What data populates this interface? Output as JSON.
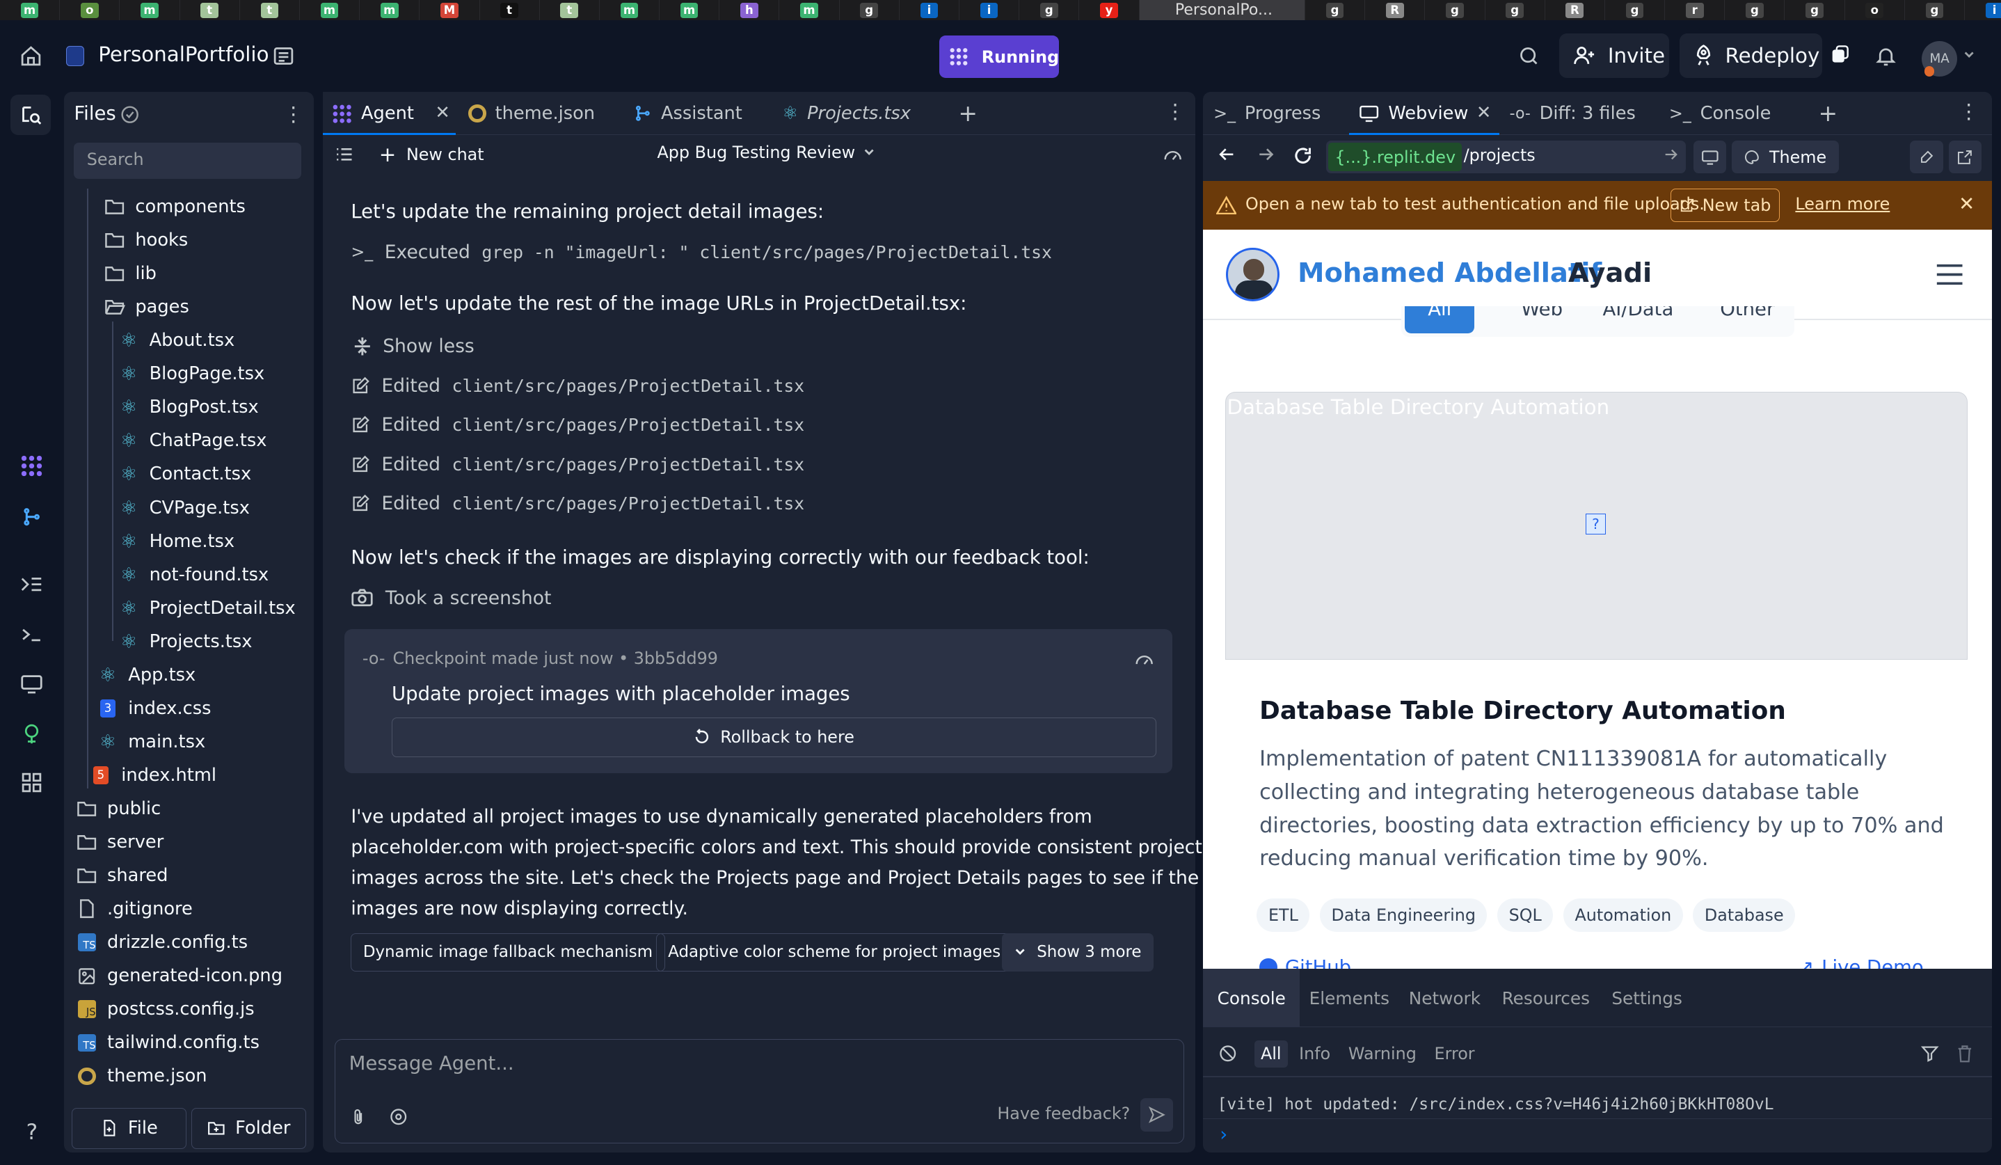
{
  "browser_tabs": {
    "active_title": "PersonalPo...",
    "favicons": [
      "m",
      "ov",
      "m",
      "tu",
      "tu",
      "m",
      "m",
      "M",
      "tt",
      "tu",
      "m",
      "m",
      "hx",
      "m",
      "gh",
      "in",
      "in",
      "gh",
      "yt",
      "active",
      "gh",
      "R",
      "gh",
      "gh",
      "R",
      "gh",
      "reddit",
      "gh",
      "gh",
      "openai",
      "gh",
      "in"
    ]
  },
  "topbar": {
    "project_name": "PersonalPortfolio",
    "status": "Running",
    "invite_label": "Invite",
    "redeploy_label": "Redeploy",
    "avatar_initials": "MA"
  },
  "files": {
    "title": "Files",
    "search_placeholder": "Search",
    "items": [
      {
        "name": "components",
        "type": "folder"
      },
      {
        "name": "hooks",
        "type": "folder"
      },
      {
        "name": "lib",
        "type": "folder"
      },
      {
        "name": "pages",
        "type": "folder-open"
      },
      {
        "name": "About.tsx",
        "type": "react"
      },
      {
        "name": "BlogPage.tsx",
        "type": "react"
      },
      {
        "name": "BlogPost.tsx",
        "type": "react"
      },
      {
        "name": "ChatPage.tsx",
        "type": "react"
      },
      {
        "name": "Contact.tsx",
        "type": "react"
      },
      {
        "name": "CVPage.tsx",
        "type": "react"
      },
      {
        "name": "Home.tsx",
        "type": "react"
      },
      {
        "name": "not-found.tsx",
        "type": "react"
      },
      {
        "name": "ProjectDetail.tsx",
        "type": "react"
      },
      {
        "name": "Projects.tsx",
        "type": "react"
      },
      {
        "name": "App.tsx",
        "type": "react"
      },
      {
        "name": "index.css",
        "type": "css"
      },
      {
        "name": "main.tsx",
        "type": "react"
      },
      {
        "name": "index.html",
        "type": "html"
      },
      {
        "name": "public",
        "type": "folder"
      },
      {
        "name": "server",
        "type": "folder"
      },
      {
        "name": "shared",
        "type": "folder"
      },
      {
        "name": ".gitignore",
        "type": "file"
      },
      {
        "name": "drizzle.config.ts",
        "type": "ts"
      },
      {
        "name": "generated-icon.png",
        "type": "image"
      },
      {
        "name": "postcss.config.js",
        "type": "js"
      },
      {
        "name": "tailwind.config.ts",
        "type": "ts"
      },
      {
        "name": "theme.json",
        "type": "json"
      }
    ],
    "new_file_label": "File",
    "new_folder_label": "Folder"
  },
  "agent_tabs": [
    {
      "label": "Agent"
    },
    {
      "label": "theme.json"
    },
    {
      "label": "Assistant"
    },
    {
      "label": "Projects.tsx"
    }
  ],
  "agent_toolbar": {
    "new_chat_label": "New chat",
    "chat_title": "App Bug Testing Review"
  },
  "chat": {
    "msg1": "Let's update the remaining project detail images:",
    "exec_prefix": "Executed",
    "exec_cmd": "grep -n \"imageUrl: \" client/src/pages/ProjectDetail.tsx",
    "msg2": "Now let's update the rest of the image URLs in ProjectDetail.tsx:",
    "show_less": "Show less",
    "edit_prefix": "Edited",
    "edits": [
      "client/src/pages/ProjectDetail.tsx",
      "client/src/pages/ProjectDetail.tsx",
      "client/src/pages/ProjectDetail.tsx",
      "client/src/pages/ProjectDetail.tsx"
    ],
    "msg3": "Now let's check if the images are displaying correctly with our feedback tool:",
    "screenshot_label": "Took a screenshot",
    "checkpoint": {
      "meta": "Checkpoint made just now • 3bb5dd99",
      "title": "Update project images with placeholder images",
      "rollback_label": "Rollback to here"
    },
    "summary_lines": [
      "I've updated all project images to use dynamically generated placeholders from",
      "placeholder.com with project-specific colors and text. This should provide consistent project",
      "images across the site. Let's check the Projects page and Project Details pages to see if the",
      "images are now displaying correctly."
    ],
    "suggestions": [
      "Dynamic image fallback mechanism",
      "Adaptive color scheme for project images"
    ],
    "show_more_label": "Show 3 more",
    "input_placeholder": "Message Agent...",
    "feedback_label": "Have feedback?"
  },
  "right_tabs": [
    {
      "label": "Progress"
    },
    {
      "label": "Webview"
    },
    {
      "label": "Diff: 3 files"
    },
    {
      "label": "Console"
    }
  ],
  "webview": {
    "url_domain": "{...}.replit.dev",
    "url_path": "/projects",
    "theme_label": "Theme",
    "banner_text": "Open a new tab to test authentication and file uploads.",
    "banner_newtab": "New tab",
    "banner_learn": "Learn more",
    "site_first": "Mohamed Abdellatif",
    "site_last": "Ayadi",
    "filters": [
      "All",
      "Web",
      "AI/Data",
      "Other"
    ],
    "image_alt": "Database Table Directory Automation",
    "project_title": "Database Table Directory Automation",
    "project_desc_lines": [
      "Implementation of patent CN111339081A for automatically",
      "collecting and integrating heterogeneous database table",
      "directories, boosting data extraction efficiency by up to 70% and",
      "reducing manual verification time by 90%."
    ],
    "tags": [
      "ETL",
      "Data Engineering",
      "SQL",
      "Automation",
      "Database"
    ],
    "link_github": "GitHub",
    "link_demo": "Live Demo"
  },
  "devtools": {
    "tabs": [
      "Console",
      "Elements",
      "Network",
      "Resources",
      "Settings"
    ],
    "levels": [
      "All",
      "Info",
      "Warning",
      "Error"
    ],
    "log_line": "[vite] hot updated: /src/index.css?v=H46j4i2h60jBKkHT08OvL"
  },
  "colors": {
    "bg": "#0e1525",
    "panel": "#1c2333",
    "running": "#6b4ce6",
    "banner": "#6b3a0a",
    "accent_blue": "#3b82f6"
  }
}
